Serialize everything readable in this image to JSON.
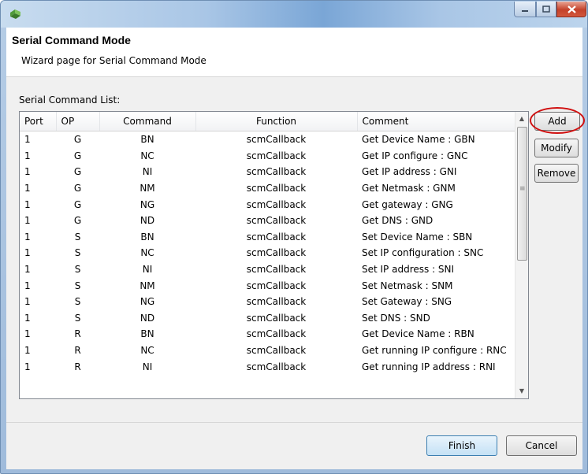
{
  "window": {
    "title": "",
    "controls": {
      "minimize_icon": "minimize-icon",
      "maximize_icon": "maximize-icon",
      "close_icon": "close-icon"
    },
    "accent_color": "#7aa6d6"
  },
  "header": {
    "title": "Serial Command Mode",
    "description": "Wizard page for Serial Command Mode"
  },
  "command_list": {
    "label": "Serial Command List:",
    "columns": [
      "Port",
      "OP",
      "Command",
      "Function",
      "Comment"
    ],
    "rows": [
      [
        "1",
        "G",
        "BN",
        "scmCallback",
        "Get Device Name : GBN"
      ],
      [
        "1",
        "G",
        "NC",
        "scmCallback",
        "Get IP configure : GNC"
      ],
      [
        "1",
        "G",
        "NI",
        "scmCallback",
        "Get IP address : GNI"
      ],
      [
        "1",
        "G",
        "NM",
        "scmCallback",
        "Get Netmask : GNM"
      ],
      [
        "1",
        "G",
        "NG",
        "scmCallback",
        "Get gateway : GNG"
      ],
      [
        "1",
        "G",
        "ND",
        "scmCallback",
        "Get DNS : GND"
      ],
      [
        "1",
        "S",
        "BN",
        "scmCallback",
        "Set Device Name : SBN"
      ],
      [
        "1",
        "S",
        "NC",
        "scmCallback",
        "Set IP configuration : SNC"
      ],
      [
        "1",
        "S",
        "NI",
        "scmCallback",
        "Set IP address : SNI"
      ],
      [
        "1",
        "S",
        "NM",
        "scmCallback",
        "Set Netmask : SNM"
      ],
      [
        "1",
        "S",
        "NG",
        "scmCallback",
        "Set Gateway : SNG"
      ],
      [
        "1",
        "S",
        "ND",
        "scmCallback",
        "Set DNS : SND"
      ],
      [
        "1",
        "R",
        "BN",
        "scmCallback",
        "Get Device Name : RBN"
      ],
      [
        "1",
        "R",
        "NC",
        "scmCallback",
        "Get running IP configure : RNC"
      ],
      [
        "1",
        "R",
        "NI",
        "scmCallback",
        "Get running IP address : RNI"
      ]
    ]
  },
  "side_buttons": {
    "add": "Add",
    "modify": "Modify",
    "remove": "Remove"
  },
  "footer": {
    "finish": "Finish",
    "cancel": "Cancel"
  },
  "annotation": {
    "color": "#d01010"
  }
}
